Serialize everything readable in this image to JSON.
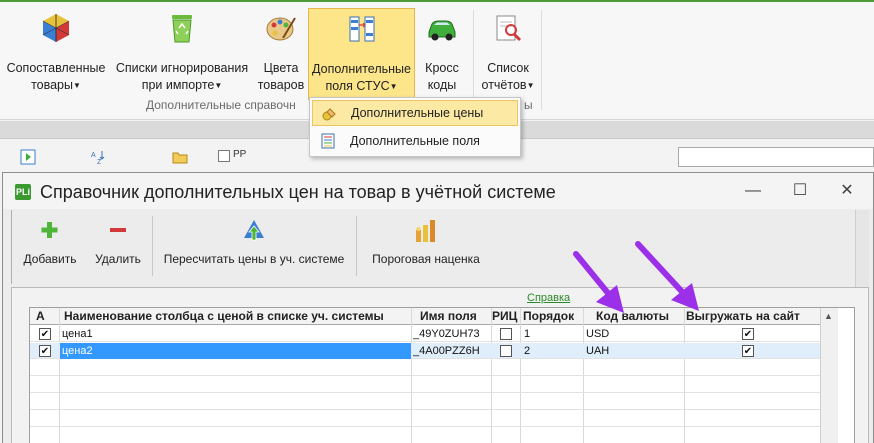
{
  "ribbon": {
    "buttons": [
      {
        "line1": "Сопоставленные",
        "line2": "товары",
        "icon": "cube-icon"
      },
      {
        "line1": "Списки игнорирования",
        "line2": "при импорте",
        "icon": "recycle-bin-icon"
      },
      {
        "line1": "Цвета",
        "line2": "товаров",
        "icon": "palette-icon"
      },
      {
        "line1": "Дополнительные",
        "line2": "поля СТУС",
        "icon": "table-fields-icon"
      },
      {
        "line1": "Кросс",
        "line2": "коды",
        "icon": "car-icon"
      },
      {
        "line1": "Список",
        "line2": "отчётов",
        "icon": "report-search-icon"
      }
    ],
    "group_label": "Дополнительные справочн",
    "group_label_tail": "ы"
  },
  "dropdown": {
    "items": [
      {
        "label": "Дополнительные цены",
        "icon": "extra-prices-icon"
      },
      {
        "label": "Дополнительные поля",
        "icon": "extra-fields-icon"
      }
    ]
  },
  "toolstrip": {
    "checkbox_label": "PP"
  },
  "dialog": {
    "title": "Справочник дополнительных цен на товар в учётной системе",
    "app_icon_text": "PLi",
    "window_controls": {
      "minimize": "—",
      "maximize": "☐",
      "close": "✕"
    },
    "toolbar": {
      "add": "Добавить",
      "delete": "Удалить",
      "recalc": "Пересчитать цены в уч. системе",
      "threshold": "Пороговая наценка"
    },
    "help_link": "Справка",
    "table": {
      "columns": [
        "А",
        "Наименование столбца с ценой в списке уч. системы",
        "Имя поля",
        "РИЦ",
        "Порядок",
        "Код валюты",
        "Выгружать на сайт"
      ],
      "rows": [
        {
          "active": true,
          "name": "цена1",
          "field": "_49Y0ZUH73",
          "ric": false,
          "order": "1",
          "currency": "USD",
          "export": true
        },
        {
          "active": true,
          "name": "цена2",
          "field": "_4A00PZZ6H",
          "ric": false,
          "order": "2",
          "currency": "UAH",
          "export": true
        }
      ]
    }
  },
  "colors": {
    "accent_green": "#4e9b3a",
    "selection_blue": "#3399ff",
    "highlight_yellow": "#fde58a",
    "arrow_purple": "#9b30e8"
  }
}
